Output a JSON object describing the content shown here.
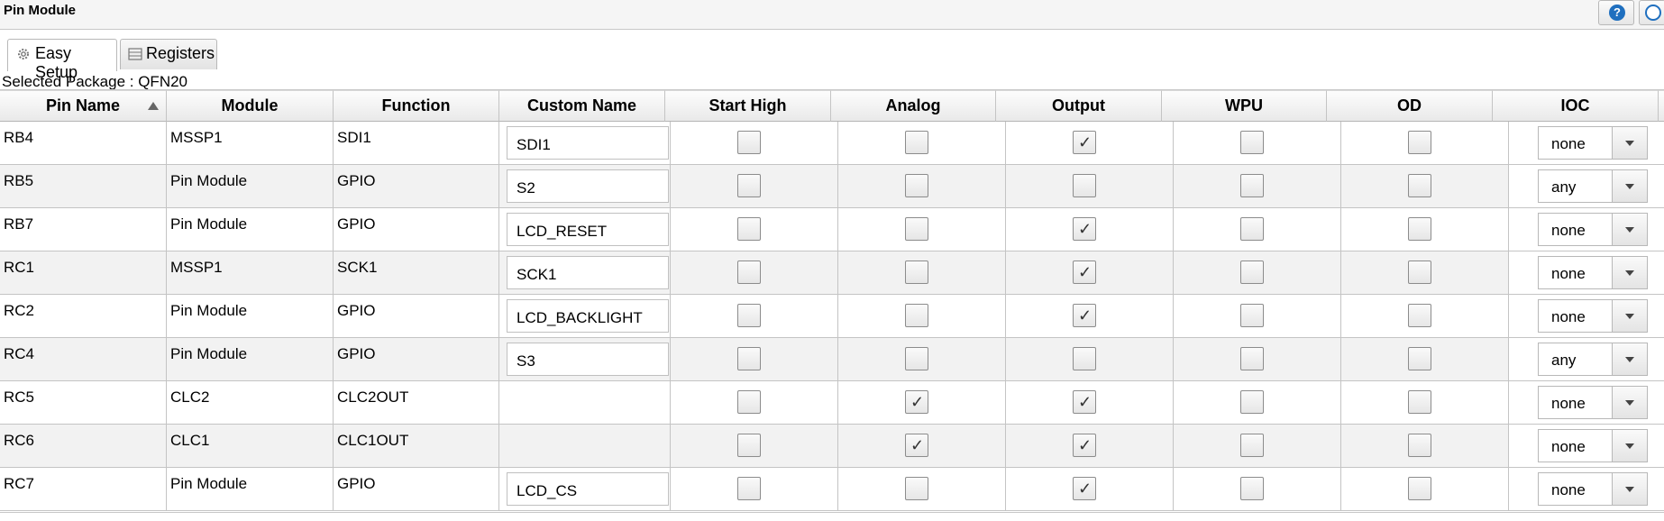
{
  "window": {
    "title": "Pin Module"
  },
  "toolbar": {
    "help_icon": "question-icon",
    "globe_icon": "globe-icon",
    "help_glyph": "?"
  },
  "tabs": [
    {
      "label": "Easy Setup",
      "icon": "gear-icon",
      "active": true
    },
    {
      "label": "Registers",
      "icon": "list-icon",
      "active": false
    }
  ],
  "package": {
    "text": "Selected Package : QFN20"
  },
  "table": {
    "columns": [
      "Pin Name",
      "Module",
      "Function",
      "Custom Name",
      "Start High",
      "Analog",
      "Output",
      "WPU",
      "OD",
      "IOC"
    ],
    "sort_column": "Pin Name",
    "sort_direction": "ascending",
    "rows": [
      {
        "pin": "RB4",
        "module": "MSSP1",
        "function": "SDI1",
        "custom": "SDI1",
        "start_high": false,
        "analog": false,
        "output": true,
        "wpu": false,
        "od": false,
        "ioc": "none"
      },
      {
        "pin": "RB5",
        "module": "Pin Module",
        "function": "GPIO",
        "custom": "S2",
        "start_high": false,
        "analog": false,
        "output": false,
        "wpu": false,
        "od": false,
        "ioc": "any"
      },
      {
        "pin": "RB7",
        "module": "Pin Module",
        "function": "GPIO",
        "custom": "LCD_RESET",
        "start_high": false,
        "analog": false,
        "output": true,
        "wpu": false,
        "od": false,
        "ioc": "none"
      },
      {
        "pin": "RC1",
        "module": "MSSP1",
        "function": "SCK1",
        "custom": "SCK1",
        "start_high": false,
        "analog": false,
        "output": true,
        "wpu": false,
        "od": false,
        "ioc": "none"
      },
      {
        "pin": "RC2",
        "module": "Pin Module",
        "function": "GPIO",
        "custom": "LCD_BACKLIGHT",
        "start_high": false,
        "analog": false,
        "output": true,
        "wpu": false,
        "od": false,
        "ioc": "none"
      },
      {
        "pin": "RC4",
        "module": "Pin Module",
        "function": "GPIO",
        "custom": "S3",
        "start_high": false,
        "analog": false,
        "output": false,
        "wpu": false,
        "od": false,
        "ioc": "any"
      },
      {
        "pin": "RC5",
        "module": "CLC2",
        "function": "CLC2OUT",
        "custom": null,
        "start_high": false,
        "analog": true,
        "output": true,
        "wpu": false,
        "od": false,
        "ioc": "none"
      },
      {
        "pin": "RC6",
        "module": "CLC1",
        "function": "CLC1OUT",
        "custom": null,
        "start_high": false,
        "analog": true,
        "output": true,
        "wpu": false,
        "od": false,
        "ioc": "none"
      },
      {
        "pin": "RC7",
        "module": "Pin Module",
        "function": "GPIO",
        "custom": "LCD_CS",
        "start_high": false,
        "analog": false,
        "output": true,
        "wpu": false,
        "od": false,
        "ioc": "none"
      }
    ]
  },
  "colors": {
    "row_alt": "#f2f2f2",
    "help_blue": "#1f6fbf",
    "checkmark": "#333333"
  }
}
